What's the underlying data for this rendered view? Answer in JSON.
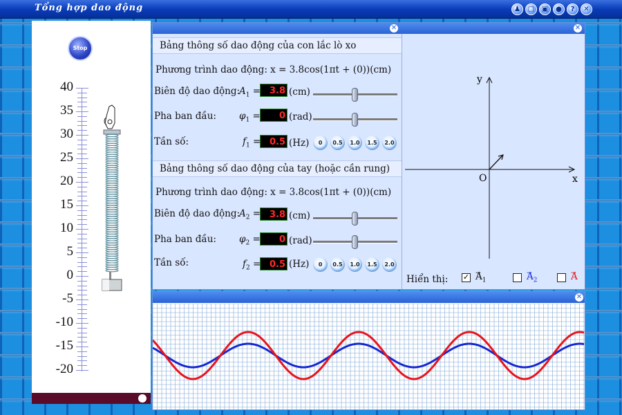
{
  "window": {
    "title": "Tổng hợp dao động",
    "buttons": [
      "person-icon",
      "window-icon",
      "copy-icon",
      "record-icon",
      "help-icon",
      "close-icon"
    ],
    "button_glyphs": [
      "♟",
      "▢",
      "▣",
      "●",
      "?",
      "✕"
    ]
  },
  "left_panel": {
    "stop_label": "Stop",
    "ruler_labels": [
      "40",
      "35",
      "30",
      "25",
      "20",
      "15",
      "10",
      "5",
      "0",
      "-5",
      "-10",
      "-15",
      "-20"
    ]
  },
  "osc_panel": {
    "title": "Bảng thông số dao động của con lắc lò xo",
    "equation": "Phương trình dao động: x = 3.8cos(1πt + (0))(cm)",
    "amplitude_label": "Biên độ dao động:",
    "amplitude_symbol": "A",
    "amplitude_sub": "1",
    "amplitude_value": "3.8",
    "amplitude_unit": "(cm)",
    "phase_label": "Pha ban đầu:",
    "phase_symbol": "φ",
    "phase_sub": "1",
    "phase_value": "0",
    "phase_unit": "(rad)",
    "freq_label": "Tần số:",
    "freq_symbol": "f",
    "freq_sub": "1",
    "freq_value": "0.5",
    "freq_unit": "(Hz)",
    "freq_buttons": [
      "0",
      "0.5",
      "1.0",
      "1.5",
      "2.0"
    ],
    "equals": "="
  },
  "hand_panel": {
    "title": "Bảng thông số dao động của tay (hoặc cần rung)",
    "equation": "Phương trình dao động: x = 3.8cos(1πt + (0))(cm)",
    "amplitude_label": "Biên độ dao động:",
    "amplitude_symbol": "A",
    "amplitude_sub": "2",
    "amplitude_value": "3.8",
    "amplitude_unit": "(cm)",
    "phase_label": "Pha ban đầu:",
    "phase_symbol": "φ",
    "phase_sub": "2",
    "phase_value": "0",
    "phase_unit": "(rad)",
    "freq_label": "Tần số:",
    "freq_symbol": "f",
    "freq_sub": "2",
    "freq_value": "0.5",
    "freq_unit": "(Hz)",
    "freq_buttons": [
      "0",
      "0.5",
      "1.0",
      "1.5",
      "2.0"
    ],
    "equals": "="
  },
  "vector_panel": {
    "y_label": "y",
    "x_label": "x",
    "origin_label": "O",
    "show_label": "Hiển thị:",
    "options": [
      {
        "label": "A",
        "sub": "1",
        "checked": true,
        "color": "#111111"
      },
      {
        "label": "A",
        "sub": "2",
        "checked": false,
        "color": "#1a2fd8"
      },
      {
        "label": "A",
        "sub": "",
        "checked": false,
        "color": "#e01818"
      }
    ],
    "check_glyph": "✓"
  },
  "colors": {
    "wave1": "#e8141c",
    "wave2": "#1428d0",
    "grid": "#7fa7d8"
  }
}
